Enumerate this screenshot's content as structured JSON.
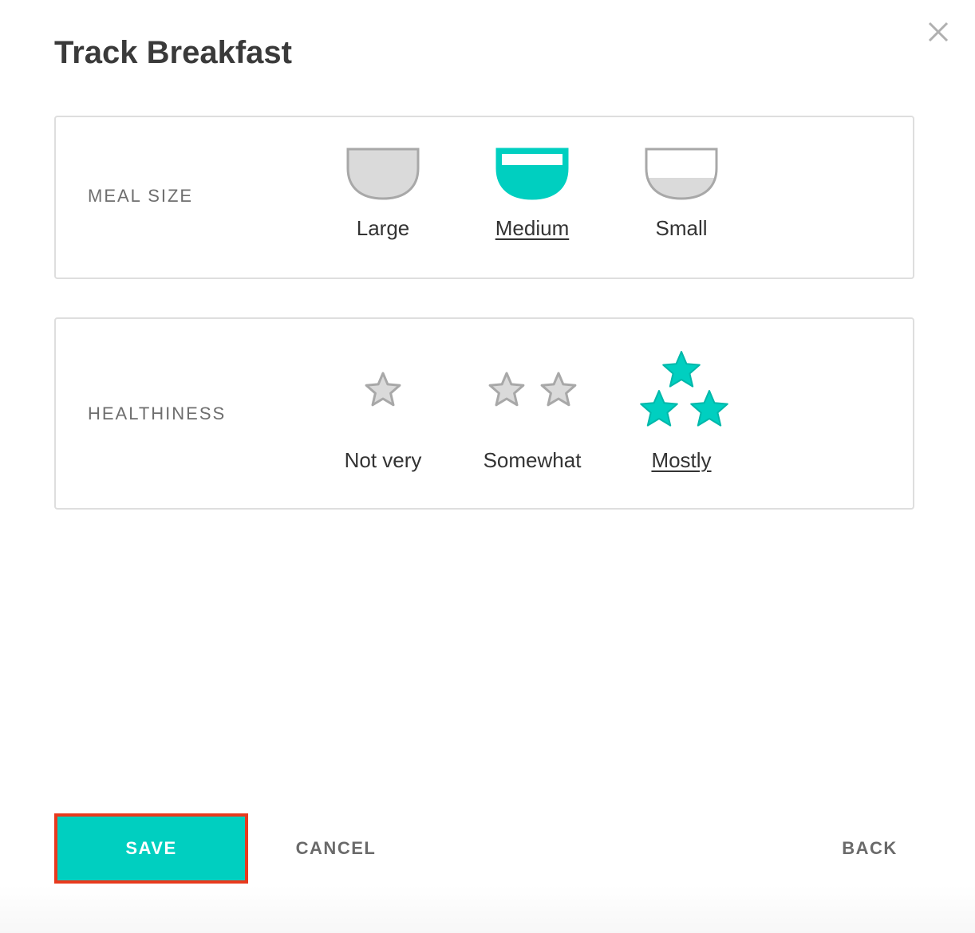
{
  "dialog": {
    "title": "Track Breakfast",
    "close_icon": "close-icon"
  },
  "meal_size": {
    "label": "MEAL SIZE",
    "selected": "Medium",
    "options": [
      {
        "label": "Large",
        "icon": "bowl-full-icon",
        "fill_level": 1.0
      },
      {
        "label": "Medium",
        "icon": "bowl-medium-icon",
        "fill_level": 0.6
      },
      {
        "label": "Small",
        "icon": "bowl-small-icon",
        "fill_level": 0.3
      }
    ]
  },
  "healthiness": {
    "label": "HEALTHINESS",
    "selected": "Mostly",
    "options": [
      {
        "label": "Not very",
        "icon": "star-icon",
        "stars": 1
      },
      {
        "label": "Somewhat",
        "icon": "star-icon",
        "stars": 2
      },
      {
        "label": "Mostly",
        "icon": "star-icon",
        "stars": 3
      }
    ]
  },
  "actions": {
    "save": "SAVE",
    "cancel": "CANCEL",
    "back": "BACK"
  },
  "colors": {
    "accent": "#00cfc0",
    "inactive_icon": "#dadada",
    "inactive_stroke": "#a8a8a8",
    "highlight_border": "#e8391d"
  }
}
